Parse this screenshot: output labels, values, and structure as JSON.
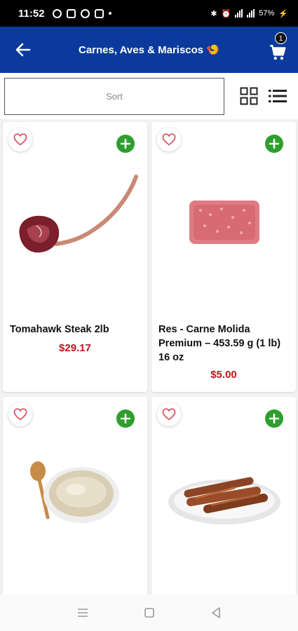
{
  "status_bar": {
    "time": "11:52",
    "battery": "57%",
    "signal_text": "⁴ᴳ"
  },
  "header": {
    "title": "Carnes, Aves & Mariscos 🍤",
    "cart_count": "1"
  },
  "toolbar": {
    "sort_label": "Sort"
  },
  "products": [
    {
      "name": "Tomahawk Steak 2lb",
      "price": "$29.17"
    },
    {
      "name": "Res - Carne Molida Premium – 453.59 g (1 lb) 16 oz",
      "price": "$5.00"
    },
    {
      "name": "",
      "price": ""
    },
    {
      "name": "",
      "price": ""
    }
  ],
  "colors": {
    "header_bg": "#0a3a9c",
    "add_green": "#2e9e2e",
    "price_red": "#c0161b"
  },
  "icons": [
    "back-arrow-icon",
    "cart-icon",
    "grid-view-icon",
    "list-view-icon",
    "heart-icon",
    "plus-icon"
  ]
}
